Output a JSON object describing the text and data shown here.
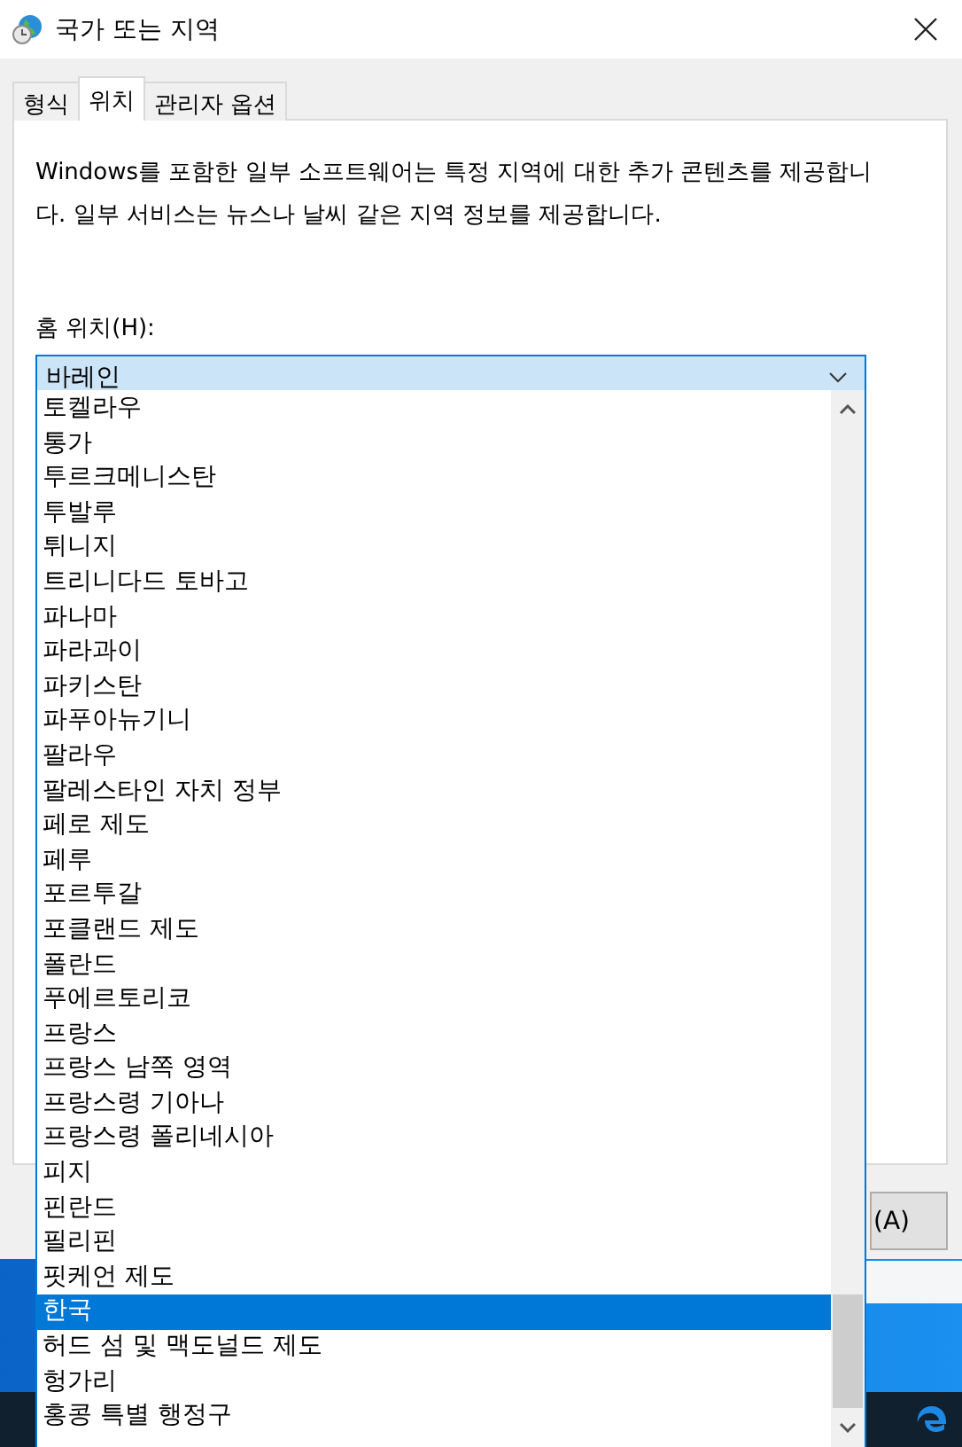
{
  "window": {
    "title": "국가 또는 지역"
  },
  "tabs": [
    {
      "label": "형식",
      "selected": false
    },
    {
      "label": "위치",
      "selected": true
    },
    {
      "label": "관리자 옵션",
      "selected": false
    }
  ],
  "description": "Windows를 포함한 일부 소프트웨어는 특정 지역에 대한 추가 콘텐츠를 제공합니다. 일부 서비스는 뉴스나 날씨 같은 지역 정보를 제공합니다.",
  "home_location": {
    "label": "홈 위치(H):",
    "value": "바레인",
    "expanded": true,
    "items": [
      {
        "label": "토켈라우",
        "selected": false
      },
      {
        "label": "통가",
        "selected": false
      },
      {
        "label": "투르크메니스탄",
        "selected": false
      },
      {
        "label": "투발루",
        "selected": false
      },
      {
        "label": "튀니지",
        "selected": false
      },
      {
        "label": "트리니다드 토바고",
        "selected": false
      },
      {
        "label": "파나마",
        "selected": false
      },
      {
        "label": "파라과이",
        "selected": false
      },
      {
        "label": "파키스탄",
        "selected": false
      },
      {
        "label": "파푸아뉴기니",
        "selected": false
      },
      {
        "label": "팔라우",
        "selected": false
      },
      {
        "label": "팔레스타인 자치 정부",
        "selected": false
      },
      {
        "label": "페로 제도",
        "selected": false
      },
      {
        "label": "페루",
        "selected": false
      },
      {
        "label": "포르투갈",
        "selected": false
      },
      {
        "label": "포클랜드 제도",
        "selected": false
      },
      {
        "label": "폴란드",
        "selected": false
      },
      {
        "label": "푸에르토리코",
        "selected": false
      },
      {
        "label": "프랑스",
        "selected": false
      },
      {
        "label": "프랑스 남쪽 영역",
        "selected": false
      },
      {
        "label": "프랑스령 기아나",
        "selected": false
      },
      {
        "label": "프랑스령 폴리네시아",
        "selected": false
      },
      {
        "label": "피지",
        "selected": false
      },
      {
        "label": "핀란드",
        "selected": false
      },
      {
        "label": "필리핀",
        "selected": false
      },
      {
        "label": "핏케언 제도",
        "selected": false
      },
      {
        "label": "한국",
        "selected": true
      },
      {
        "label": "허드 섬 및 맥도널드 제도",
        "selected": false
      },
      {
        "label": "헝가리",
        "selected": false
      },
      {
        "label": "홍콩 특별 행정구",
        "selected": false
      }
    ]
  },
  "apply_button": {
    "label": "(A)"
  }
}
